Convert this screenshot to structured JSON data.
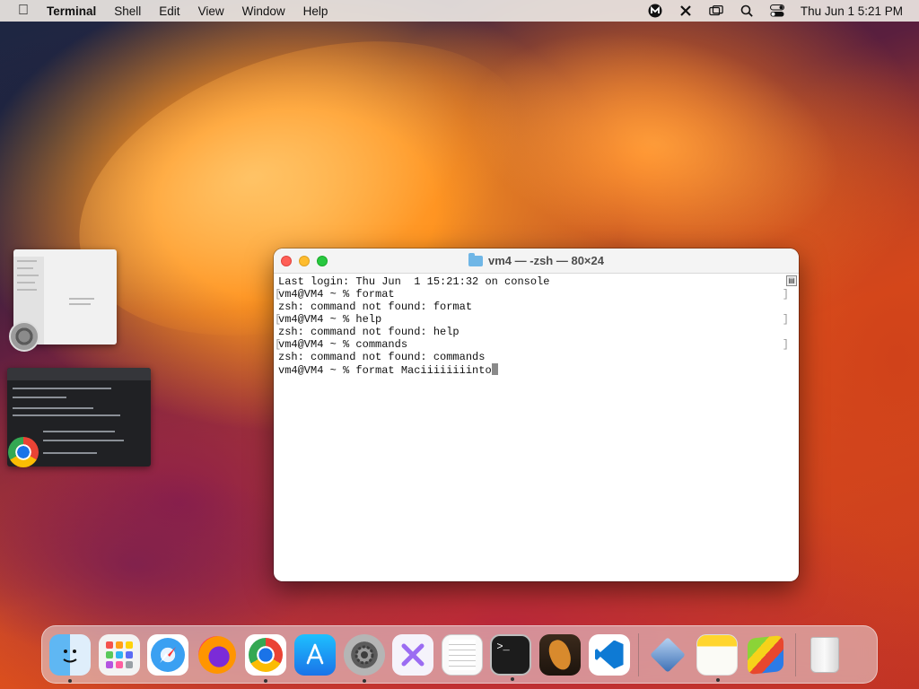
{
  "menubar": {
    "app_name": "Terminal",
    "menus": [
      "Shell",
      "Edit",
      "View",
      "Window",
      "Help"
    ],
    "clock": "Thu Jun 1  5:21 PM",
    "status_icons": [
      "malwarebytes-icon",
      "xcode-tools-icon",
      "screen-mirror-icon",
      "spotlight-search-icon",
      "control-center-icon"
    ]
  },
  "terminal": {
    "title": "vm4 — -zsh — 80×24",
    "lines": [
      "Last login: Thu Jun  1 15:21:32 on console",
      "vm4@VM4 ~ % format",
      "zsh: command not found: format",
      "vm4@VM4 ~ % help",
      "zsh: command not found: help",
      "vm4@VM4 ~ % commands",
      "zsh: command not found: commands",
      "vm4@VM4 ~ % format Maciiiiiiiinto"
    ]
  },
  "thumbnails": [
    "system-settings-window",
    "chrome-window"
  ],
  "dock": {
    "apps": [
      {
        "name": "Finder",
        "running": true
      },
      {
        "name": "Launchpad",
        "running": false
      },
      {
        "name": "Safari",
        "running": false
      },
      {
        "name": "Firefox",
        "running": false
      },
      {
        "name": "Google Chrome",
        "running": true
      },
      {
        "name": "App Store",
        "running": false
      },
      {
        "name": "System Settings",
        "running": true
      },
      {
        "name": "UTM",
        "running": false
      },
      {
        "name": "TextEdit",
        "running": false
      },
      {
        "name": "Terminal",
        "running": true
      },
      {
        "name": "GarageBand",
        "running": false
      },
      {
        "name": "Visual Studio Code",
        "running": false
      },
      {
        "name": "VirtualBox",
        "running": false
      },
      {
        "name": "Notes",
        "running": true
      },
      {
        "name": "BlueStacks",
        "running": false
      },
      {
        "name": "Trash",
        "running": false
      }
    ],
    "terminal_prompt": ">_"
  },
  "colors": {
    "close": "#ff5f57",
    "minimize": "#febc2e",
    "zoom": "#28c840",
    "folder_icon": "#6fb6e6"
  }
}
